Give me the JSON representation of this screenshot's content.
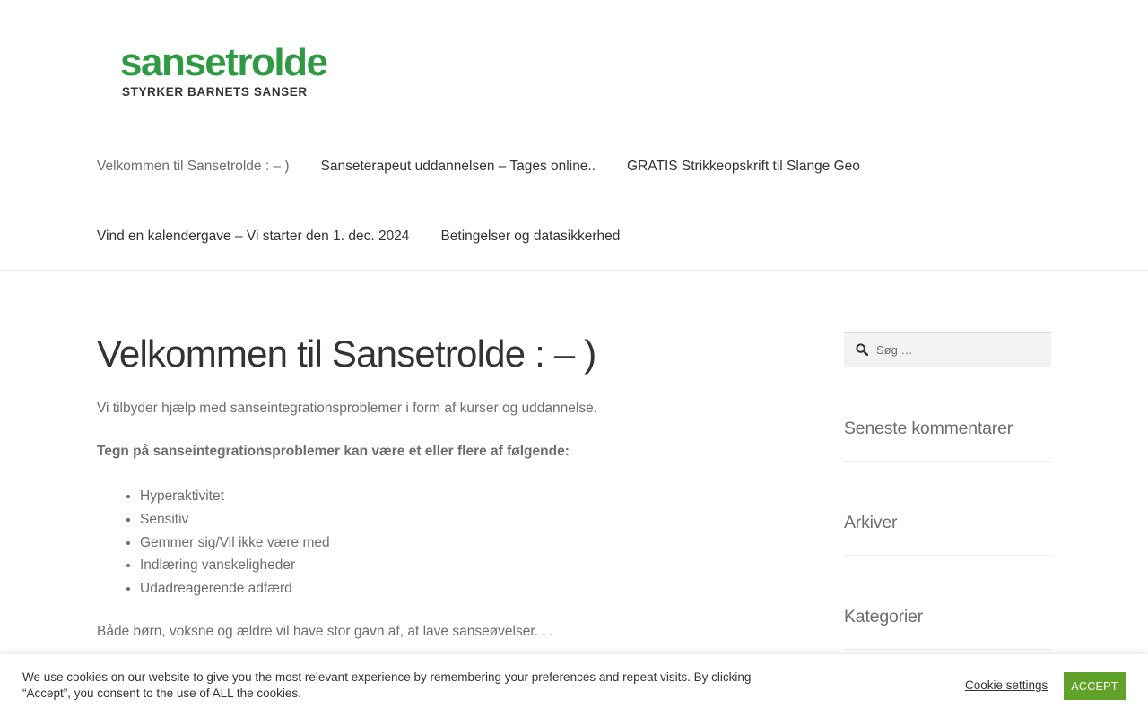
{
  "header": {
    "logo": {
      "wordmark": "sansetrolde",
      "tagline": "STYRKER  BARNETS SANSER"
    },
    "nav": {
      "row1": [
        {
          "label": "Velkommen til Sansetrolde : – )",
          "current": true
        },
        {
          "label": "Sanseterapeut uddannelsen – Tages online..",
          "current": false
        },
        {
          "label": "GRATIS Strikkeopskrift til Slange Geo",
          "current": false
        }
      ],
      "row2": [
        {
          "label": "Vind en kalendergave – Vi starter den 1. dec. 2024",
          "current": false
        },
        {
          "label": "Betingelser og datasikkerhed",
          "current": false
        }
      ]
    }
  },
  "main": {
    "title": "Velkommen til Sansetrolde : – )",
    "intro": "Vi tilbyder hjælp med sanseintegrationsproblemer i form af kurser og uddannelse.",
    "list_heading": "Tegn på sanseintegrationsproblemer kan være et eller flere af følgende:",
    "list": [
      "Hyperaktivitet",
      "Sensitiv",
      "Gemmer sig/Vil ikke være med",
      "Indlæring vanskeligheder",
      "Udadreagerende adfærd"
    ],
    "closing": "Både børn, voksne og ældre vil have stor gavn af, at lave sanseøvelser. . ."
  },
  "sidebar": {
    "search_placeholder": "Søg …",
    "widgets": [
      "Seneste kommentarer",
      "Arkiver",
      "Kategorier"
    ]
  },
  "cookie": {
    "text": "We use cookies on our website to give you the most relevant experience by remembering your preferences and repeat visits. By clicking “Accept”, you consent to the use of ALL the cookies.",
    "settings_label": "Cookie settings",
    "accept_label": "ACCEPT"
  },
  "colors": {
    "accent_button": "#61a229",
    "logo_green": "#2f9a43",
    "heading": "#333333",
    "body_text": "#6d6d6d"
  }
}
